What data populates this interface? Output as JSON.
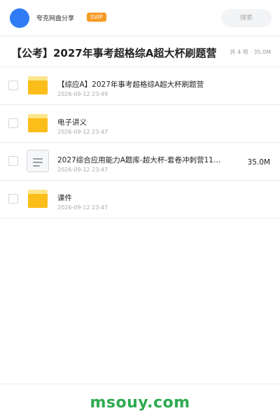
{
  "header": {
    "share_name": "夸克网盘分享",
    "badge": "SVIP",
    "search_placeholder": "搜索",
    "accent": "#2f7cf6",
    "badge_color": "#f59a23"
  },
  "folder": {
    "title": "【公考】2027年事考超格综A超大杯刷题营",
    "summary": "共 4 项 · 35.0M"
  },
  "files": [
    {
      "type": "folder",
      "icon": "folder-icon",
      "name": "【综应A】2027年事考超格综A超大杯刷题营",
      "time": "2026-09-12 23:49",
      "size": ""
    },
    {
      "type": "folder",
      "icon": "folder-icon",
      "name": "电子讲义",
      "time": "2026-09-12 23:47",
      "size": ""
    },
    {
      "type": "document",
      "icon": "document-icon",
      "name": "2027综合应用能力A题库-超大杯-套卷冲刺营11…",
      "time": "2026-09-12 23:47",
      "size": "35.0M"
    },
    {
      "type": "folder",
      "icon": "folder-icon",
      "name": "课件",
      "time": "2026-09-12 23:47",
      "size": ""
    }
  ],
  "footer": {
    "watermark": "msouy.com",
    "watermark_color": "#2eaa4f"
  }
}
